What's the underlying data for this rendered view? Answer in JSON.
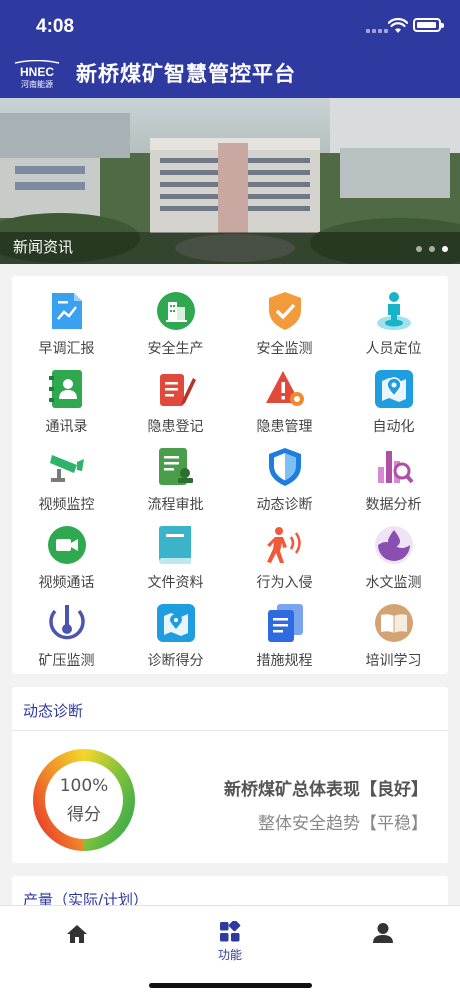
{
  "status_bar": {
    "time": "4:08"
  },
  "header": {
    "logo_line1": "HNEC",
    "logo_line2": "河南能源",
    "title": "新桥煤矿智慧管控平台"
  },
  "banner": {
    "caption": "新闻资讯",
    "pages": 3,
    "active_page": 3
  },
  "functions": [
    {
      "label": "早调汇报",
      "icon": "report-chart-icon",
      "color": "#3aa0f0"
    },
    {
      "label": "安全生产",
      "icon": "building-icon",
      "color": "#2fa84f"
    },
    {
      "label": "安全监测",
      "icon": "shield-check-icon",
      "color": "#f39a3a"
    },
    {
      "label": "人员定位",
      "icon": "person-location-icon",
      "color": "#19b3c8"
    },
    {
      "label": "通讯录",
      "icon": "contacts-icon",
      "color": "#2fa84f"
    },
    {
      "label": "隐患登记",
      "icon": "register-pen-icon",
      "color": "#e04a3a"
    },
    {
      "label": "隐患管理",
      "icon": "warning-gear-icon",
      "color": "#e04a3a"
    },
    {
      "label": "自动化",
      "icon": "map-pin-icon",
      "color": "#1e9de0"
    },
    {
      "label": "视频监控",
      "icon": "cctv-camera-icon",
      "color": "#2fb36a"
    },
    {
      "label": "流程审批",
      "icon": "approval-document-icon",
      "color": "#4a9e4a"
    },
    {
      "label": "动态诊断",
      "icon": "shield-icon",
      "color": "#1e7de0"
    },
    {
      "label": "数据分析",
      "icon": "bar-magnifier-icon",
      "color": "#b04fa8"
    },
    {
      "label": "视频通话",
      "icon": "video-call-icon",
      "color": "#2fa84f"
    },
    {
      "label": "文件资料",
      "icon": "book-file-icon",
      "color": "#3bb3c8"
    },
    {
      "label": "行为入侵",
      "icon": "intrusion-person-icon",
      "color": "#f05a3a"
    },
    {
      "label": "水文监测",
      "icon": "water-drop-icon",
      "color": "#8a4fb0"
    },
    {
      "label": "矿压监测",
      "icon": "pressure-gauge-icon",
      "color": "#4a55b0"
    },
    {
      "label": "诊断得分",
      "icon": "map-score-icon",
      "color": "#1e9de0"
    },
    {
      "label": "措施规程",
      "icon": "documents-icon",
      "color": "#2e6ae0"
    },
    {
      "label": "培训学习",
      "icon": "open-book-icon",
      "color": "#d4a373"
    }
  ],
  "diagnosis": {
    "title": "动态诊断",
    "score_text": "100%",
    "score_label": "得分",
    "score": 1.0,
    "performance": "新桥煤矿总体表现【良好】",
    "trend": "整体安全趋势【平稳】"
  },
  "production": {
    "title": "产量（实际/计划）"
  },
  "tabbar": {
    "active_label": "功能"
  }
}
